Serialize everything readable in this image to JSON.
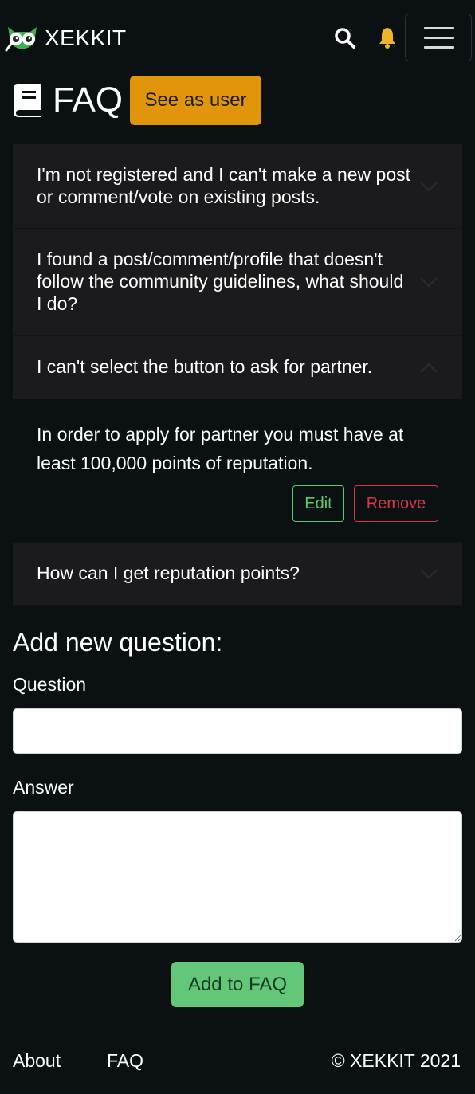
{
  "navbar": {
    "brand": "XEKKIT",
    "icons": {
      "logo": "owl-logo-icon",
      "search": "search-icon",
      "notifications": "bell-icon",
      "menu": "hamburger-menu-icon"
    },
    "colors": {
      "bell": "#f0b429",
      "brand_green": "#3fae4f"
    }
  },
  "header": {
    "title": "FAQ",
    "icon": "book-icon",
    "see_as_user_label": "See as user"
  },
  "faq": {
    "items": [
      {
        "question": "I'm not registered and I can't make a new post or comment/vote on existing posts.",
        "expanded": false
      },
      {
        "question": "I found a post/comment/profile that doesn't follow the community guidelines, what should I do?",
        "expanded": false
      },
      {
        "question": "I can't select the button to ask for partner.",
        "expanded": true,
        "answer": "In order to apply for partner you must have at least 100,000 points of reputation.",
        "edit_label": "Edit",
        "remove_label": "Remove"
      },
      {
        "question": "How can I get reputation points?",
        "expanded": false
      }
    ]
  },
  "form": {
    "title": "Add new question:",
    "question_label": "Question",
    "question_value": "",
    "answer_label": "Answer",
    "answer_value": "",
    "submit_label": "Add to FAQ"
  },
  "footer": {
    "about": "About",
    "faq": "FAQ",
    "copyright": "© XEKKIT 2021"
  },
  "colors": {
    "background": "#0b1113",
    "accordion_bg": "#1b1b1d",
    "warning": "#e0950a",
    "success": "#63c77a",
    "danger": "#dc3545"
  }
}
